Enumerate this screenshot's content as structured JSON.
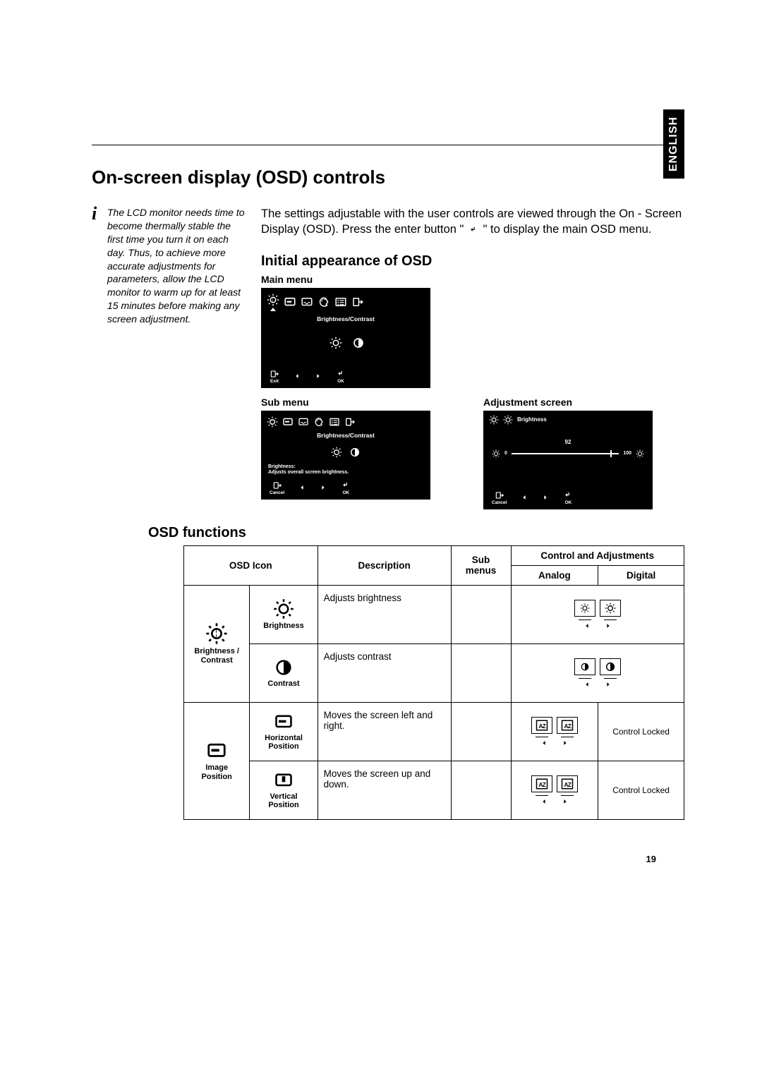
{
  "language_tab": "ENGLISH",
  "title": "On-screen display (OSD) controls",
  "info_note": "The LCD monitor needs time to become thermally stable the first time you turn it on each day. Thus, to achieve more accurate adjustments for parameters, allow the LCD monitor to warm up for  at least 15 minutes before making any screen adjustment.",
  "intro_part1": "The settings adjustable with the user controls are viewed through the On - Screen Display (OSD). Press the enter button \"",
  "intro_part2": "\" to display the main OSD menu.",
  "section_initial": "Initial appearance of OSD",
  "label_main_menu": "Main menu",
  "label_sub_menu": "Sub menu",
  "label_adj_screen": "Adjustment screen",
  "osd_main": {
    "title": "Brightness/Contrast",
    "nav_exit": "Exit",
    "nav_ok": "OK"
  },
  "osd_sub": {
    "title": "Brightness/Contrast",
    "hint_l1": "Brightness:",
    "hint_l2": "Adjusts overall screen brightness.",
    "nav_cancel": "Cancel",
    "nav_ok": "OK"
  },
  "osd_adj": {
    "title": "Brightness",
    "value": "92",
    "min": "0",
    "max": "100",
    "nav_cancel": "Cancel",
    "nav_ok": "OK"
  },
  "section_functions": "OSD functions",
  "table": {
    "h_icon": "OSD Icon",
    "h_desc": "Description",
    "h_sub": "Sub menus",
    "h_ctrl": "Control and Adjustments",
    "h_analog": "Analog",
    "h_digital": "Digital",
    "group_bc": "Brightness / Contrast",
    "icon_brightness": "Brightness",
    "desc_brightness": "Adjusts brightness",
    "icon_contrast": "Contrast",
    "desc_contrast": "Adjusts contrast",
    "group_ip": "Image Position",
    "icon_hpos": "Horizontal Position",
    "desc_hpos": "Moves the screen left and right.",
    "icon_vpos": "Vertical Position",
    "desc_vpos": "Moves the screen up and down.",
    "ctrl_locked": "Control Locked"
  },
  "page_number": "19"
}
